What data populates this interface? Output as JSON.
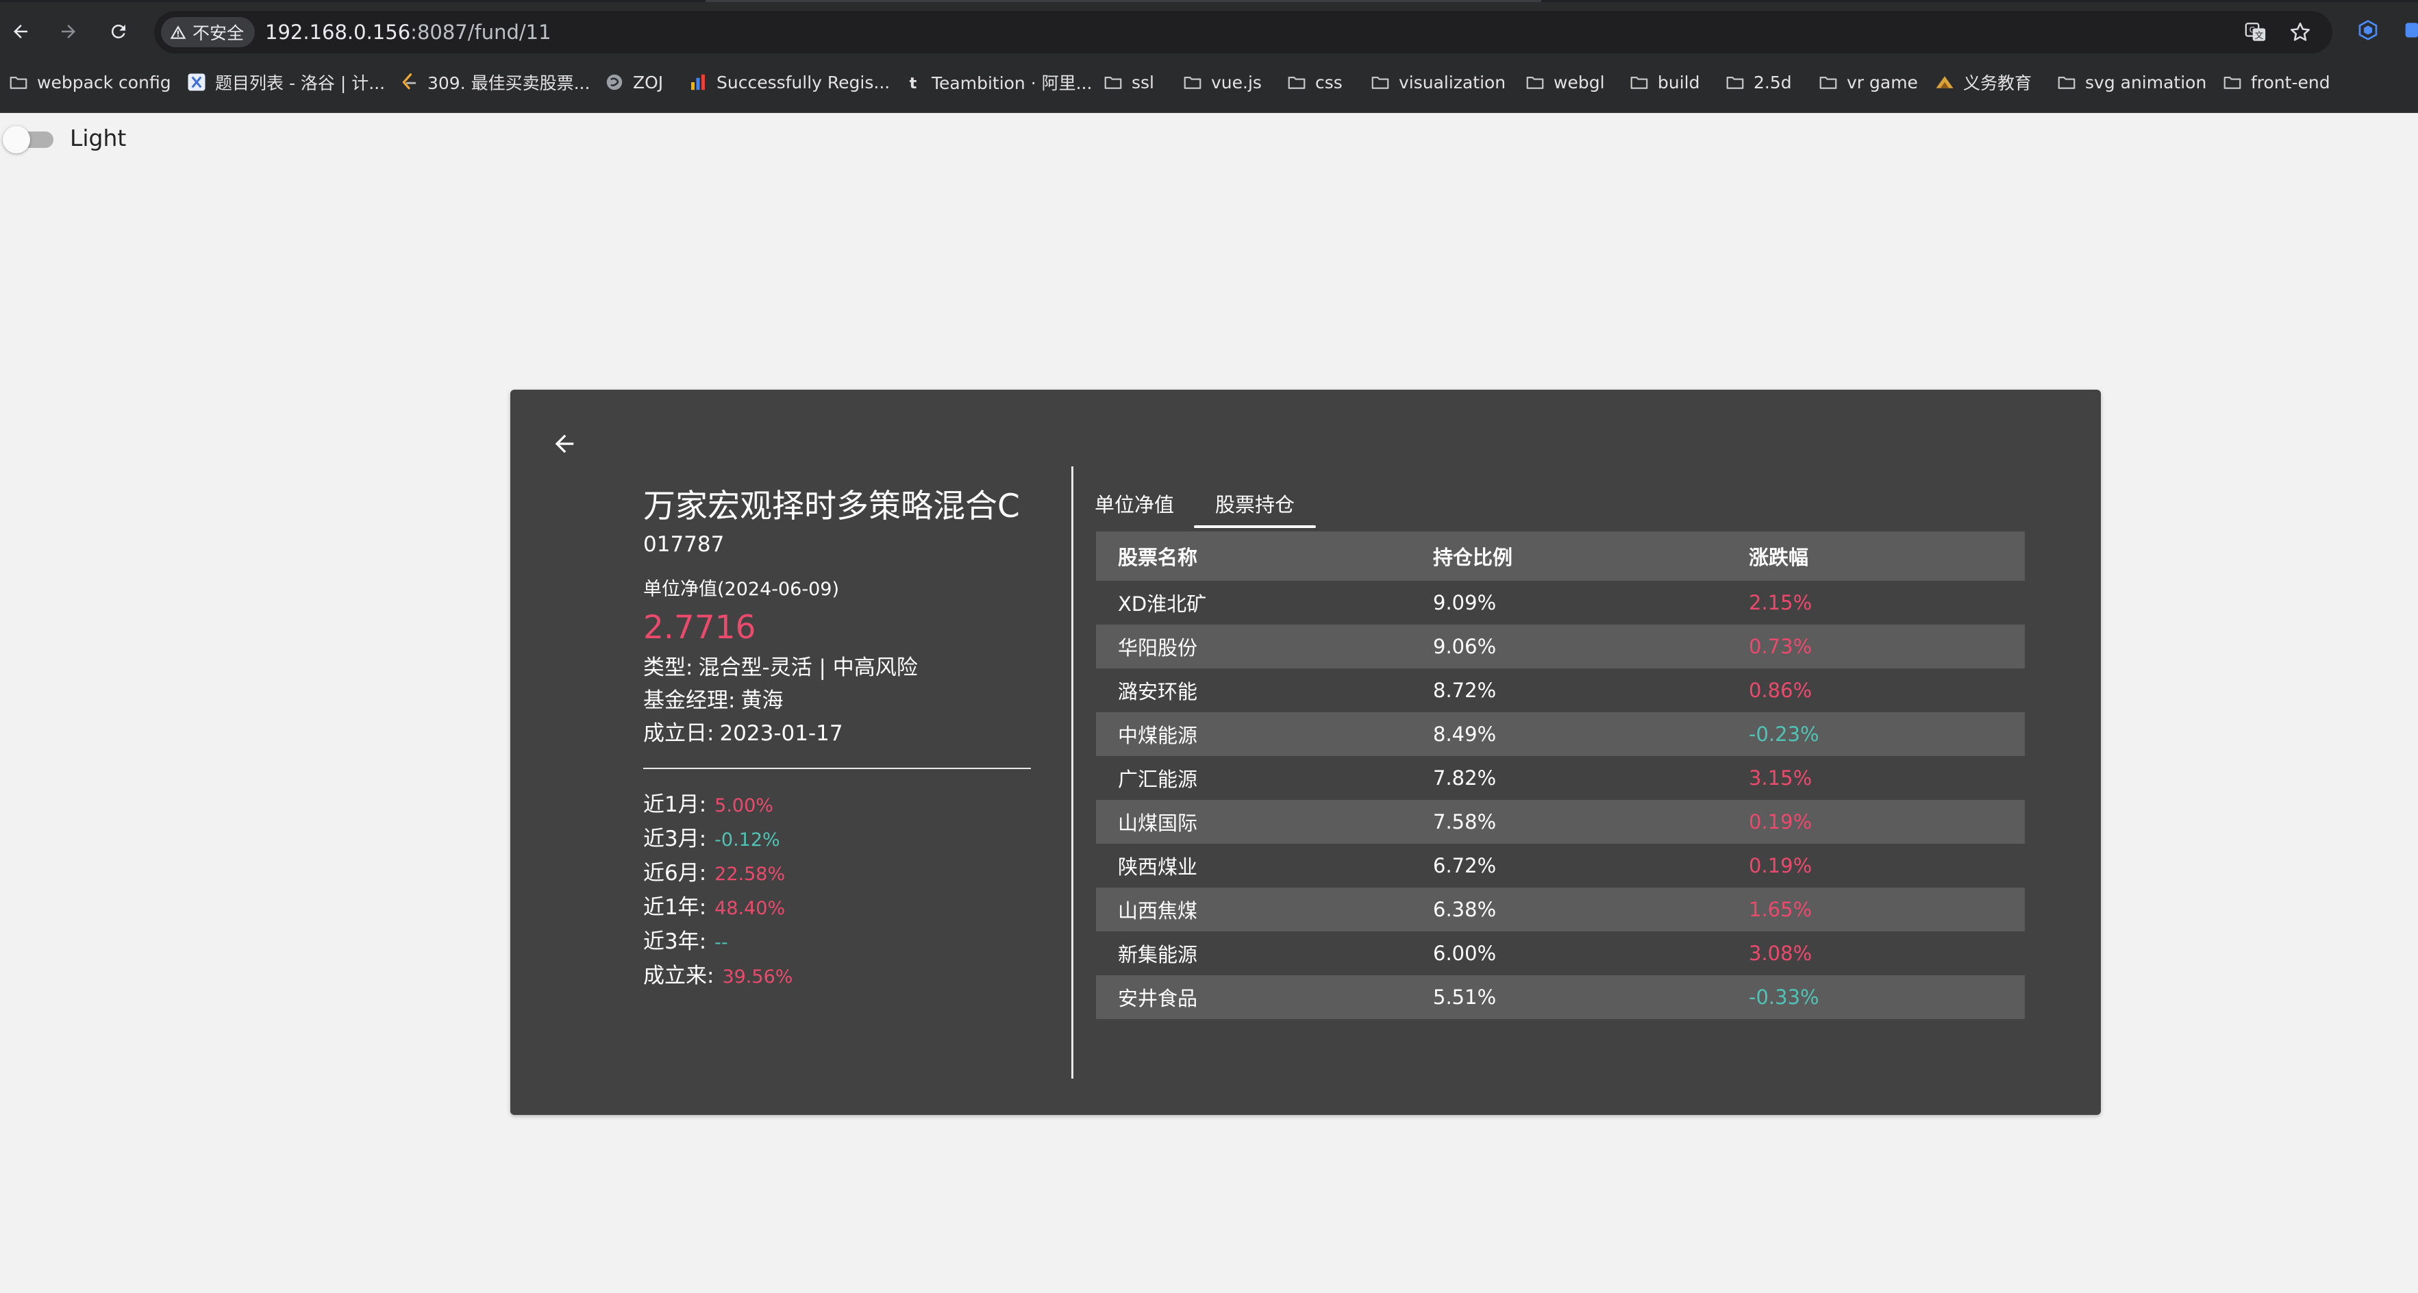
{
  "browser": {
    "security_label": "不安全",
    "url_host": "192.168.0.156",
    "url_rest": ":8087/fund/11",
    "bookmarks": [
      {
        "label": "webpack config",
        "icon": "folder-icon"
      },
      {
        "label": "题目列表 - 洛谷 | 计...",
        "icon": "luogu-icon"
      },
      {
        "label": "309. 最佳买卖股票...",
        "icon": "leetcode-icon"
      },
      {
        "label": "ZOJ",
        "icon": "zoj-icon"
      },
      {
        "label": "Successfully Regis...",
        "icon": "chart-favicon"
      },
      {
        "label": "Teambition · 阿里...",
        "icon": "teambition-icon"
      },
      {
        "label": "ssl",
        "icon": "folder-icon"
      },
      {
        "label": "vue.js",
        "icon": "folder-icon"
      },
      {
        "label": "css",
        "icon": "folder-icon"
      },
      {
        "label": "visualization",
        "icon": "folder-icon"
      },
      {
        "label": "webgl",
        "icon": "folder-icon"
      },
      {
        "label": "build",
        "icon": "folder-icon"
      },
      {
        "label": "2.5d",
        "icon": "folder-icon"
      },
      {
        "label": "vr game",
        "icon": "folder-icon"
      },
      {
        "label": "义务教育",
        "icon": "education-icon"
      },
      {
        "label": "svg animation",
        "icon": "folder-icon"
      },
      {
        "label": "front-end",
        "icon": "folder-icon"
      }
    ]
  },
  "theme_toggle": {
    "label": "Light",
    "checked": false
  },
  "fund": {
    "name": "万家宏观择时多策略混合C",
    "code": "017787",
    "nav_label": "单位净值(2024-06-09)",
    "nav_value": "2.7716",
    "type_key": "类型:",
    "type_value": "混合型-灵活 | 中高风险",
    "manager_key": "基金经理:",
    "manager_value": "黄海",
    "established_key": "成立日:",
    "established_value": "2023-01-17",
    "performance": [
      {
        "label": "近1月:",
        "value": "5.00%",
        "trend": "up"
      },
      {
        "label": "近3月:",
        "value": "-0.12%",
        "trend": "down"
      },
      {
        "label": "近6月:",
        "value": "22.58%",
        "trend": "up"
      },
      {
        "label": "近1年:",
        "value": "48.40%",
        "trend": "up"
      },
      {
        "label": "近3年:",
        "value": "--",
        "trend": "down"
      },
      {
        "label": "成立来:",
        "value": "39.56%",
        "trend": "up"
      }
    ]
  },
  "tabs": [
    {
      "label": "单位净值",
      "active": false
    },
    {
      "label": "股票持仓",
      "active": true
    }
  ],
  "holdings": {
    "headers": [
      "股票名称",
      "持仓比例",
      "涨跌幅"
    ],
    "rows": [
      {
        "name": "XD淮北矿",
        "ratio": "9.09%",
        "change": "2.15%",
        "trend": "up"
      },
      {
        "name": "华阳股份",
        "ratio": "9.06%",
        "change": "0.73%",
        "trend": "up"
      },
      {
        "name": "潞安环能",
        "ratio": "8.72%",
        "change": "0.86%",
        "trend": "up"
      },
      {
        "name": "中煤能源",
        "ratio": "8.49%",
        "change": "-0.23%",
        "trend": "down"
      },
      {
        "name": "广汇能源",
        "ratio": "7.82%",
        "change": "3.15%",
        "trend": "up"
      },
      {
        "name": "山煤国际",
        "ratio": "7.58%",
        "change": "0.19%",
        "trend": "up"
      },
      {
        "name": "陕西煤业",
        "ratio": "6.72%",
        "change": "0.19%",
        "trend": "up"
      },
      {
        "name": "山西焦煤",
        "ratio": "6.38%",
        "change": "1.65%",
        "trend": "up"
      },
      {
        "name": "新集能源",
        "ratio": "6.00%",
        "change": "3.08%",
        "trend": "up"
      },
      {
        "name": "安井食品",
        "ratio": "5.51%",
        "change": "-0.33%",
        "trend": "down"
      }
    ]
  },
  "colors": {
    "up": "#ec4a6c",
    "down": "#4fc4b4",
    "card": "#424242",
    "page": "#f2f2f2"
  }
}
